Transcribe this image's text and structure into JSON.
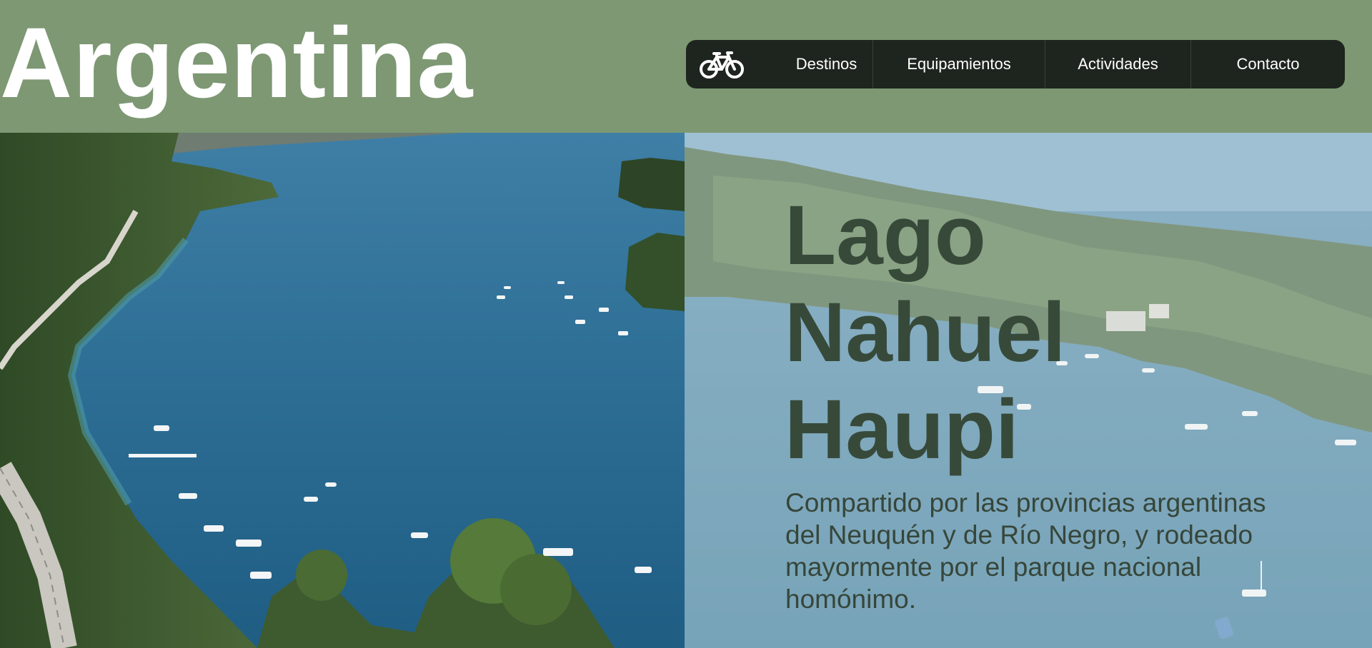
{
  "header": {
    "brand": "Argentina",
    "background_color": "#7d9873"
  },
  "nav": {
    "logo_icon": "bicycle-icon",
    "items": [
      {
        "label": "Destinos"
      },
      {
        "label": "Equipamientos"
      },
      {
        "label": "Actividades"
      },
      {
        "label": "Contacto"
      }
    ],
    "background_color": "#1e241e"
  },
  "hero": {
    "title_lines": [
      "Lago",
      "Nahuel",
      "Haupi"
    ],
    "description": "Compartido por las provincias argentinas del Neuquén y de Río Negro, y rodeado mayormente por el parque nacional homónimo.",
    "title_color": "#374a3a"
  }
}
